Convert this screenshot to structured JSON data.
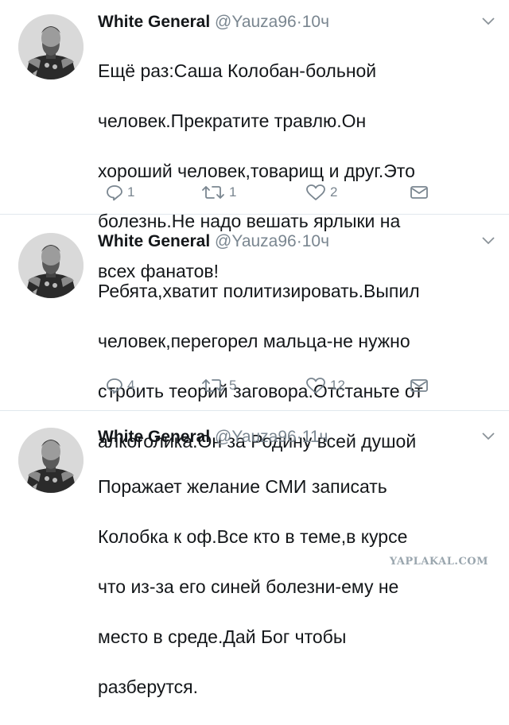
{
  "tweets": [
    {
      "author": "White General",
      "handle": "@Yauza96",
      "separator": "·",
      "time": "10ч",
      "lines": [
        "Ещё раз:Саша Колобан-больной",
        "человек.Прекратите травлю.Он",
        "хороший человек,товарищ и друг.Это",
        "болезнь.Не надо вешать ярлыки на",
        "всех фанатов!"
      ],
      "replies": "1",
      "retweets": "1",
      "likes": "2"
    },
    {
      "author": "White General",
      "handle": "@Yauza96",
      "separator": "·",
      "time": "10ч",
      "lines": [
        "Ребята,хватит политизировать.Выпил",
        "человек,перегорел мальца-не нужно",
        "строить теорий заговора.Отстаньте от",
        "алкоголика.Он за Родину всей душой"
      ],
      "replies": "4",
      "retweets": "5",
      "likes": "12"
    },
    {
      "author": "White General",
      "handle": "@Yauza96",
      "separator": "·",
      "time": "11ч",
      "lines": [
        "Поражает желание СМИ записать",
        "Колобка к оф.Все кто в теме,в курсе",
        "что из-за его синей болезни-ему не",
        "место в среде.Дай Бог чтобы",
        "разберутся."
      ]
    }
  ],
  "icons": {
    "reply": "reply-icon",
    "retweet": "retweet-icon",
    "like": "heart-icon",
    "dm": "envelope-icon",
    "more": "chevron-down-icon"
  },
  "watermark": "YAPLAKAL.COM",
  "colors": {
    "text": "#14171a",
    "meta": "#7a8690",
    "divider": "#e1e8ed"
  }
}
